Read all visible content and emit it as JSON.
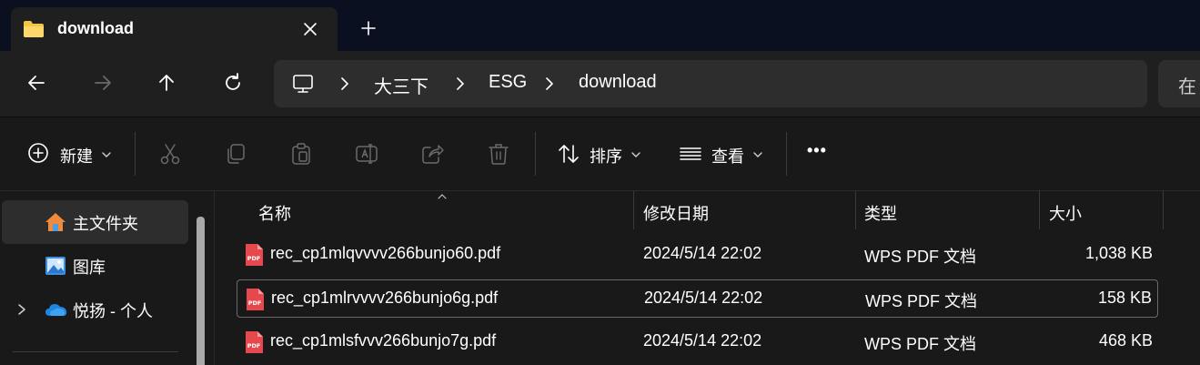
{
  "tab": {
    "title": "download",
    "folder_icon": "folder-icon",
    "close_icon": "close-icon",
    "new_tab_icon": "plus-icon"
  },
  "nav": {
    "back_icon": "arrow-left-icon",
    "forward_icon": "arrow-right-icon",
    "up_icon": "arrow-up-icon",
    "refresh_icon": "refresh-icon"
  },
  "address": {
    "root_icon": "monitor-icon",
    "crumbs": [
      "大三下",
      "ESG",
      "download"
    ]
  },
  "search": {
    "placeholder_visible": "在"
  },
  "commands": {
    "new_label": "新建",
    "sort_label": "排序",
    "view_label": "查看",
    "more_label": "•••"
  },
  "sidebar": {
    "items": [
      {
        "label": "主文件夹",
        "icon": "home-icon"
      },
      {
        "label": "图库",
        "icon": "gallery-icon"
      },
      {
        "label": "悦扬 - 个人",
        "icon": "onedrive-cloud-icon"
      }
    ]
  },
  "columns": {
    "name": "名称",
    "date": "修改日期",
    "type": "类型",
    "size": "大小"
  },
  "files": [
    {
      "name": "rec_cp1mlqvvvv266bunjo60.pdf",
      "date": "2024/5/14 22:02",
      "type": "WPS PDF 文档",
      "size": "1,038 KB"
    },
    {
      "name": "rec_cp1mlrvvvv266bunjo6g.pdf",
      "date": "2024/5/14 22:02",
      "type": "WPS PDF 文档",
      "size": "158 KB"
    },
    {
      "name": "rec_cp1mlsfvvv266bunjo7g.pdf",
      "date": "2024/5/14 22:02",
      "type": "WPS PDF 文档",
      "size": "468 KB"
    }
  ],
  "colors": {
    "background": "#191919",
    "titlebar": "#0b1021",
    "pdf_red": "#e5484d",
    "folder_yellow": "#f4c542"
  }
}
